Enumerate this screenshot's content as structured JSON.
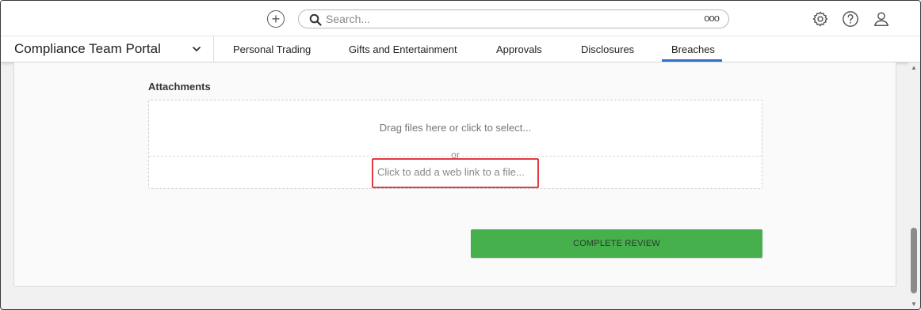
{
  "topbar": {
    "search_placeholder": "Search...",
    "search_more_label": "ooo"
  },
  "navbar": {
    "portal_title": "Compliance Team Portal",
    "tabs": [
      {
        "label": "Personal Trading"
      },
      {
        "label": "Gifts and Entertainment"
      },
      {
        "label": "Approvals"
      },
      {
        "label": "Disclosures"
      },
      {
        "label": "Breaches",
        "active": true
      }
    ]
  },
  "main": {
    "attachments_label": "Attachments",
    "dropzone_text": "Drag files here or click to select...",
    "or_text": "or",
    "web_link_text": "Click to add a web link to a file...",
    "complete_button": "COMPLETE REVIEW"
  },
  "colors": {
    "accent": "#2f6fc9",
    "complete_button": "#45b04c",
    "highlight": "#e23a3f"
  },
  "icons": {
    "add": "plus-circle-icon",
    "search": "search-icon",
    "settings": "gear-icon",
    "help": "help-icon",
    "profile": "user-icon",
    "portal_menu": "chevron-down-icon"
  }
}
